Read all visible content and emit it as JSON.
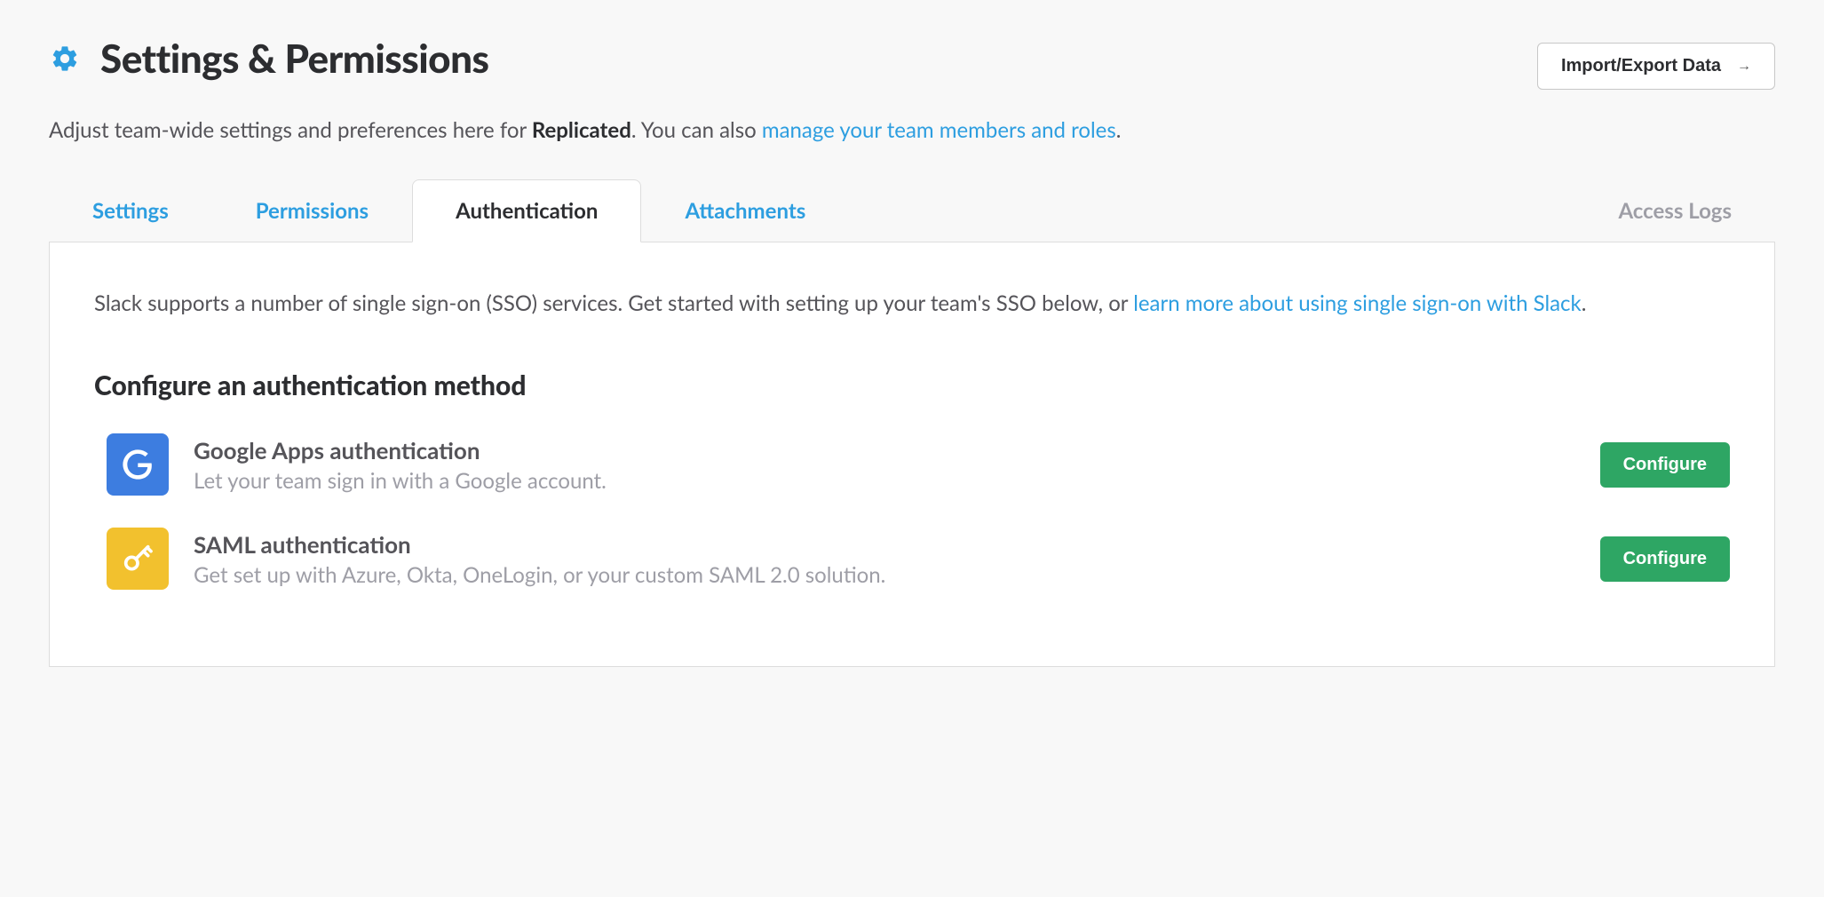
{
  "header": {
    "title": "Settings & Permissions",
    "import_export_label": "Import/Export Data"
  },
  "subtitle": {
    "prefix": "Adjust team-wide settings and preferences here for ",
    "team_name": "Replicated",
    "middle": ". You can also ",
    "link_text": "manage your team members and roles",
    "suffix": "."
  },
  "tabs": {
    "settings": "Settings",
    "permissions": "Permissions",
    "authentication": "Authentication",
    "attachments": "Attachments",
    "access_logs": "Access Logs"
  },
  "intro": {
    "text": "Slack supports a number of single sign-on (SSO) services. Get started with setting up your team's SSO below, or ",
    "link_text": "learn more about using single sign-on with Slack",
    "suffix": "."
  },
  "section_heading": "Configure an authentication method",
  "methods": {
    "google": {
      "title": "Google Apps authentication",
      "desc": "Let your team sign in with a Google account.",
      "button": "Configure"
    },
    "saml": {
      "title": "SAML authentication",
      "desc": "Get set up with Azure, Okta, OneLogin, or your custom SAML 2.0 solution.",
      "button": "Configure"
    }
  }
}
